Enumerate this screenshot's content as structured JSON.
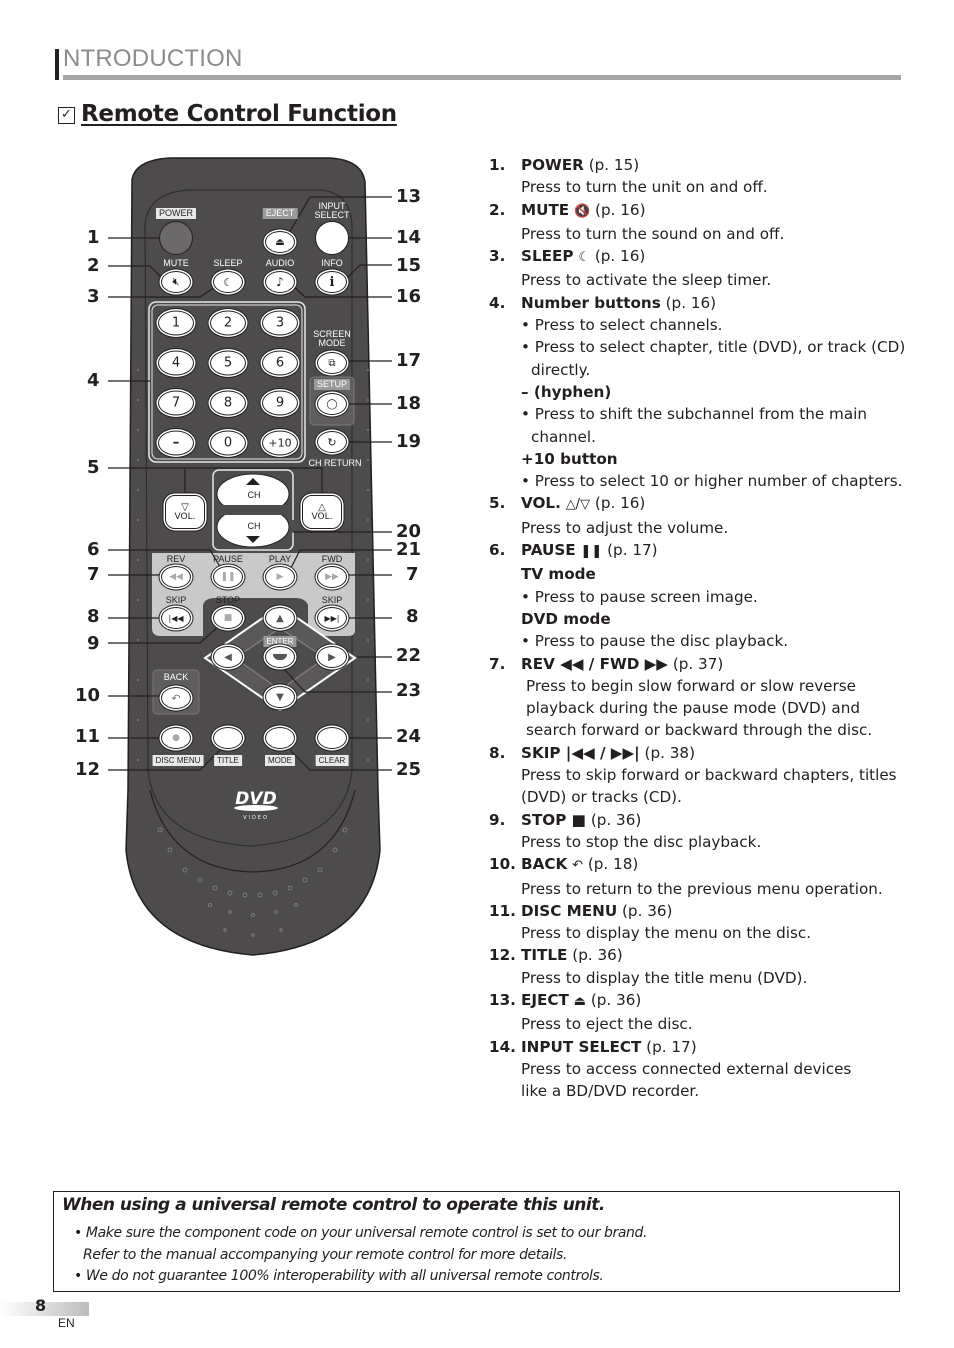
{
  "header": {
    "section_title": "NTRODUCTION",
    "heading_check_icon": "checkbox-checked-icon",
    "heading": "Remote Control Function"
  },
  "remote": {
    "labels": {
      "power": "POWER",
      "eject": "EJECT",
      "input_select_1": "INPUT",
      "input_select_2": "SELECT",
      "mute": "MUTE",
      "sleep": "SLEEP",
      "audio": "AUDIO",
      "info": "INFO",
      "screen_mode_1": "SCREEN",
      "screen_mode_2": "MODE",
      "setup": "SETUP",
      "ch_return": "CH RETURN",
      "vol": "VOL.",
      "ch": "CH",
      "rev": "REV",
      "pause": "PAUSE",
      "play": "PLAY",
      "fwd": "FWD",
      "skip": "SKIP",
      "stop": "STOP",
      "enter": "ENTER",
      "back": "BACK",
      "disc_menu": "DISC MENU",
      "title": "TITLE",
      "mode": "MODE",
      "clear": "CLEAR",
      "logo_main": "DVD",
      "logo_sub": "VIDEO"
    },
    "number_keys": [
      "1",
      "2",
      "3",
      "4",
      "5",
      "6",
      "7",
      "8",
      "9",
      "–",
      "0",
      "+10"
    ],
    "icons": {
      "mute": "mute-speaker-icon",
      "sleep": "sleep-moon-icon",
      "audio": "music-note-icon",
      "info": "info-icon",
      "eject": "eject-icon",
      "screen_mode": "screen-mode-icon",
      "setup": "setup-icon",
      "ch_return": "ch-return-icon"
    },
    "callouts_left": [
      "1",
      "2",
      "3",
      "4",
      "5",
      "6",
      "7",
      "8",
      "9",
      "10",
      "11",
      "12"
    ],
    "callouts_right": [
      "13",
      "14",
      "15",
      "16",
      "17",
      "18",
      "19",
      "20",
      "21",
      "7",
      "8",
      "22",
      "23",
      "24",
      "25"
    ]
  },
  "functions": [
    {
      "num": "1.",
      "name": "POWER",
      "symbol": "",
      "page": "(p. 15)",
      "lines": [
        {
          "type": "desc",
          "text": "Press to turn the unit on and off."
        }
      ]
    },
    {
      "num": "2.",
      "name": "MUTE",
      "symbol": "🔇",
      "page": "(p. 16)",
      "lines": [
        {
          "type": "desc",
          "text": "Press to turn the sound on and off."
        }
      ]
    },
    {
      "num": "3.",
      "name": "SLEEP",
      "symbol": "☾",
      "page": "(p. 16)",
      "lines": [
        {
          "type": "desc",
          "text": "Press to activate the sleep timer."
        }
      ]
    },
    {
      "num": "4.",
      "name": "Number buttons",
      "symbol": "",
      "page": "(p. 16)",
      "lines": [
        {
          "type": "bullet",
          "text": "• Press to select channels."
        },
        {
          "type": "bullet",
          "text": "• Press to select chapter, title (DVD), or track (CD) directly."
        },
        {
          "type": "sub",
          "text": "– (hyphen)"
        },
        {
          "type": "bullet",
          "text": "• Press to shift the subchannel from the main channel."
        },
        {
          "type": "sub",
          "text": "+10 button"
        },
        {
          "type": "bullet",
          "text": "• Press to select 10 or higher number of chapters."
        }
      ]
    },
    {
      "num": "5.",
      "name": "VOL.",
      "symbol": "△/▽",
      "page": "(p. 16)",
      "lines": [
        {
          "type": "desc",
          "text": "Press to adjust the volume."
        }
      ]
    },
    {
      "num": "6.",
      "name": "PAUSE",
      "symbol": "❚❚",
      "page": "(p. 17)",
      "lines": [
        {
          "type": "sub",
          "text": "TV mode"
        },
        {
          "type": "bullet",
          "text": "• Press to pause screen image."
        },
        {
          "type": "sub",
          "text": "DVD mode"
        },
        {
          "type": "bullet",
          "text": "• Press to pause the disc playback."
        }
      ]
    },
    {
      "num": "7.",
      "name": "REV ◀◀ / FWD ▶▶",
      "symbol": "",
      "page": "(p. 37)",
      "lines": [
        {
          "type": "ind",
          "text": "Press to begin slow forward or slow reverse"
        },
        {
          "type": "ind",
          "text": "playback during the pause mode (DVD) and"
        },
        {
          "type": "ind",
          "text": "search forward or backward through the disc."
        }
      ]
    },
    {
      "num": "8.",
      "name": "SKIP |◀◀ / ▶▶|",
      "symbol": "",
      "page": "(p. 38)",
      "lines": [
        {
          "type": "desc",
          "text": "Press to skip forward or backward chapters, titles (DVD) or tracks (CD)."
        }
      ]
    },
    {
      "num": "9.",
      "name": "STOP ■",
      "symbol": "",
      "page": "(p. 36)",
      "lines": [
        {
          "type": "desc",
          "text": "Press to stop the disc playback."
        }
      ]
    },
    {
      "num": "10.",
      "name": "BACK",
      "symbol": "↶",
      "page": "(p. 18)",
      "lines": [
        {
          "type": "desc",
          "text": "Press to return to the previous menu operation."
        }
      ]
    },
    {
      "num": "11.",
      "name": "DISC MENU",
      "symbol": "",
      "page": "(p. 36)",
      "lines": [
        {
          "type": "desc",
          "text": "Press to display the menu on the disc."
        }
      ]
    },
    {
      "num": "12.",
      "name": "TITLE",
      "symbol": "",
      "page": "(p. 36)",
      "lines": [
        {
          "type": "desc",
          "text": "Press to display the title menu (DVD)."
        }
      ]
    },
    {
      "num": "13.",
      "name": "EJECT",
      "symbol": "⏏",
      "page": "(p. 36)",
      "lines": [
        {
          "type": "desc",
          "text": "Press to eject the disc."
        }
      ]
    },
    {
      "num": "14.",
      "name": "INPUT SELECT",
      "symbol": "",
      "page": "(p. 17)",
      "lines": [
        {
          "type": "desc",
          "text": "Press to access connected external devices"
        },
        {
          "type": "desc",
          "text": "like a BD/DVD recorder."
        }
      ]
    }
  ],
  "note": {
    "title": "When using a universal remote control to operate this unit.",
    "lines": [
      "• Make sure the component code on your universal remote control is set to our brand.",
      "  Refer to the manual accompanying your remote control for more details.",
      "• We do not guarantee 100% interoperability with all universal remote controls."
    ]
  },
  "footer": {
    "page_number": "8",
    "language": "EN"
  },
  "colors": {
    "remote_body": "#4d4b4b",
    "remote_panel": "#5a5858",
    "remote_light_panel": "#c9c9c9",
    "text": "#231f20",
    "section_title": "#8c8c8c",
    "rule": "#a7a7a7"
  }
}
